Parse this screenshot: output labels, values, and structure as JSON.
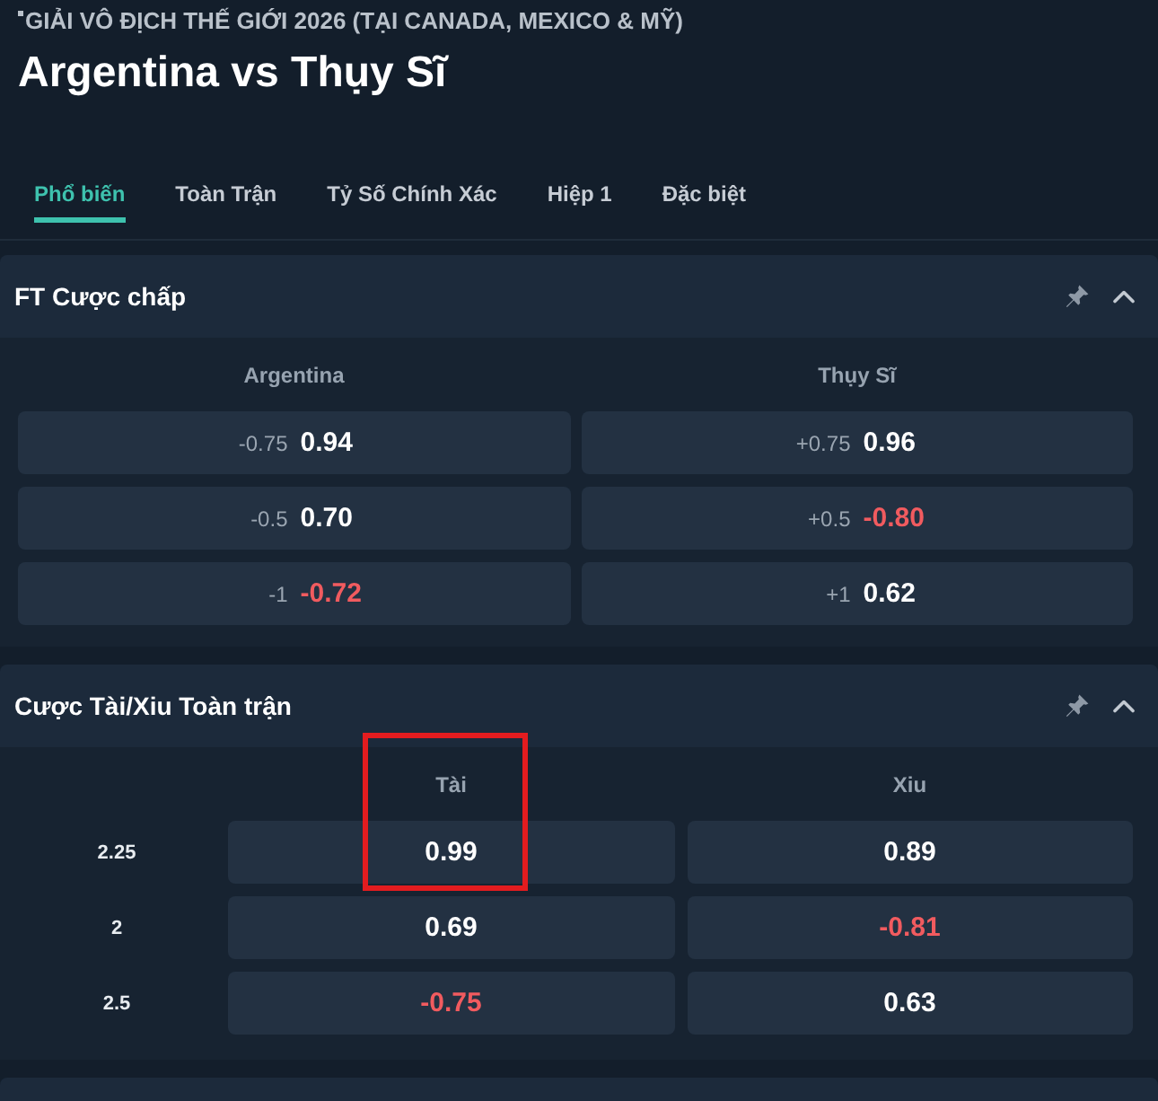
{
  "league": {
    "title": "GIẢI VÔ ĐỊCH THẾ GIỚI 2026 (TẠI CANADA, MEXICO & MỸ)"
  },
  "match": {
    "title": "Argentina vs Thụy Sĩ"
  },
  "tabs": [
    {
      "label": "Phổ biến",
      "selected": true
    },
    {
      "label": "Toàn Trận",
      "selected": false
    },
    {
      "label": "Tỷ Số Chính Xác",
      "selected": false
    },
    {
      "label": "Hiệp 1",
      "selected": false
    },
    {
      "label": "Đặc biệt",
      "selected": false
    }
  ],
  "markets": [
    {
      "kind": "handicap",
      "title": "FT Cược chấp",
      "expanded": true,
      "columns": [
        "Argentina",
        "Thụy Sĩ"
      ],
      "rows": [
        {
          "cells": [
            {
              "line": "-0.75",
              "odds": "0.94",
              "negative": false
            },
            {
              "line": "+0.75",
              "odds": "0.96",
              "negative": false
            }
          ]
        },
        {
          "cells": [
            {
              "line": "-0.5",
              "odds": "0.70",
              "negative": false
            },
            {
              "line": "+0.5",
              "odds": "-0.80",
              "negative": true
            }
          ]
        },
        {
          "cells": [
            {
              "line": "-1",
              "odds": "-0.72",
              "negative": true
            },
            {
              "line": "+1",
              "odds": "0.62",
              "negative": false
            }
          ]
        }
      ]
    },
    {
      "kind": "over_under",
      "title": "Cược Tài/Xiu Toàn trận",
      "expanded": true,
      "columns": [
        "Tài",
        "Xiu"
      ],
      "rows": [
        {
          "line": "2.25",
          "cells": [
            {
              "odds": "0.99",
              "negative": false,
              "highlighted": true
            },
            {
              "odds": "0.89",
              "negative": false,
              "highlighted": false
            }
          ]
        },
        {
          "line": "2",
          "cells": [
            {
              "odds": "0.69",
              "negative": false,
              "highlighted": false
            },
            {
              "odds": "-0.81",
              "negative": true,
              "highlighted": false
            }
          ]
        },
        {
          "line": "2.5",
          "cells": [
            {
              "odds": "-0.75",
              "negative": true,
              "highlighted": false
            },
            {
              "odds": "0.63",
              "negative": false,
              "highlighted": false
            }
          ]
        }
      ]
    }
  ]
}
